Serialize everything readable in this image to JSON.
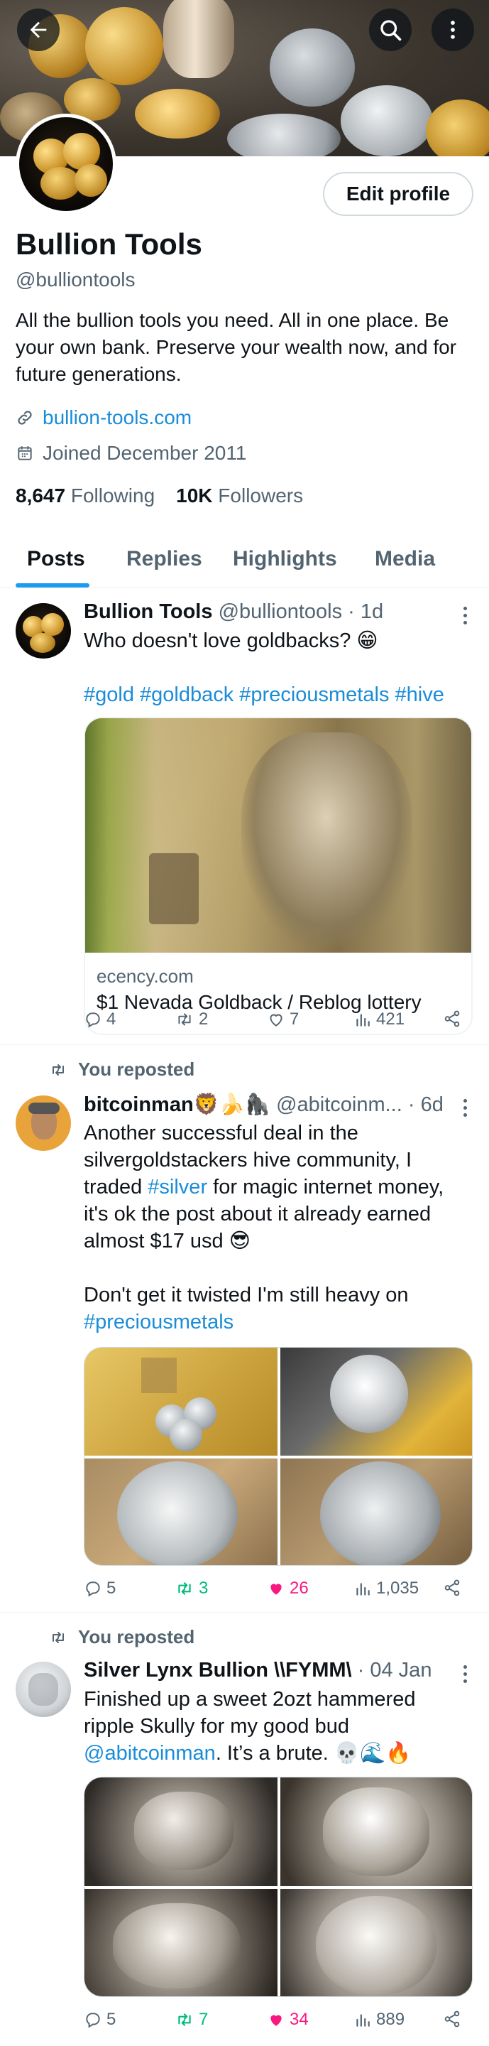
{
  "header": {
    "back_icon": "arrow-left-icon",
    "search_icon": "search-icon",
    "more_icon": "more-vertical-icon"
  },
  "profile": {
    "edit_label": "Edit profile",
    "name": "Bullion Tools",
    "handle": "@bulliontools",
    "bio": "All the bullion tools you need. All in one place. Be your own bank. Preserve your wealth now, and for future generations.",
    "website": "bullion-tools.com",
    "joined": "Joined December 2011",
    "following_count": "8,647",
    "following_label": "Following",
    "followers_count": "10K",
    "followers_label": "Followers"
  },
  "tabs": [
    {
      "label": "Posts",
      "active": true
    },
    {
      "label": "Replies"
    },
    {
      "label": "Highlights"
    },
    {
      "label": "Media"
    }
  ],
  "colors": {
    "accent": "#1d9bf0",
    "link": "#1a8cd8",
    "like": "#f91880",
    "repost": "#00ba7c",
    "muted": "#536471"
  },
  "posts": [
    {
      "name": "Bullion Tools",
      "handle": "@bulliontools",
      "time": "· 1d",
      "text1": "Who doesn't love goldbacks? 😁",
      "tags": "#gold #goldback #preciousmetals #hive",
      "card": {
        "domain": "ecency.com",
        "title": "$1 Nevada Goldback / Reblog lottery"
      },
      "stats": {
        "replies": "4",
        "reposts": "2",
        "likes": "7",
        "views": "421"
      }
    },
    {
      "repost_label": "You reposted",
      "name": "bitcoinman🦁🍌🦍",
      "handle": "@abitcoinm...",
      "time": "· 6d",
      "line1": "Another successful deal in the",
      "line2": "silvergoldstackers hive community, I",
      "line3_pre": "traded ",
      "line3_tag": "#silver",
      "line3_post": " for magic internet money,",
      "line4": "it's ok the post about it already earned",
      "line5": "almost $17 usd 😎",
      "line6": "Don't get it twisted I'm still heavy on",
      "line7_tag": "#preciousmetals",
      "stats": {
        "replies": "5",
        "reposts": "3",
        "likes": "26",
        "views": "1,035"
      }
    },
    {
      "repost_label": "You reposted",
      "name": "Silver Lynx Bullion \\\\FYMM\\",
      "time": "· 04 Jan",
      "line1": "Finished up a sweet 2ozt hammered",
      "line2": "ripple Skully for my good bud",
      "line3_mention": "@abitcoinman",
      "line3_post": ". It’s a brute. 💀🌊🔥",
      "stats": {
        "replies": "5",
        "reposts": "7",
        "likes": "34",
        "views": "889"
      }
    }
  ]
}
